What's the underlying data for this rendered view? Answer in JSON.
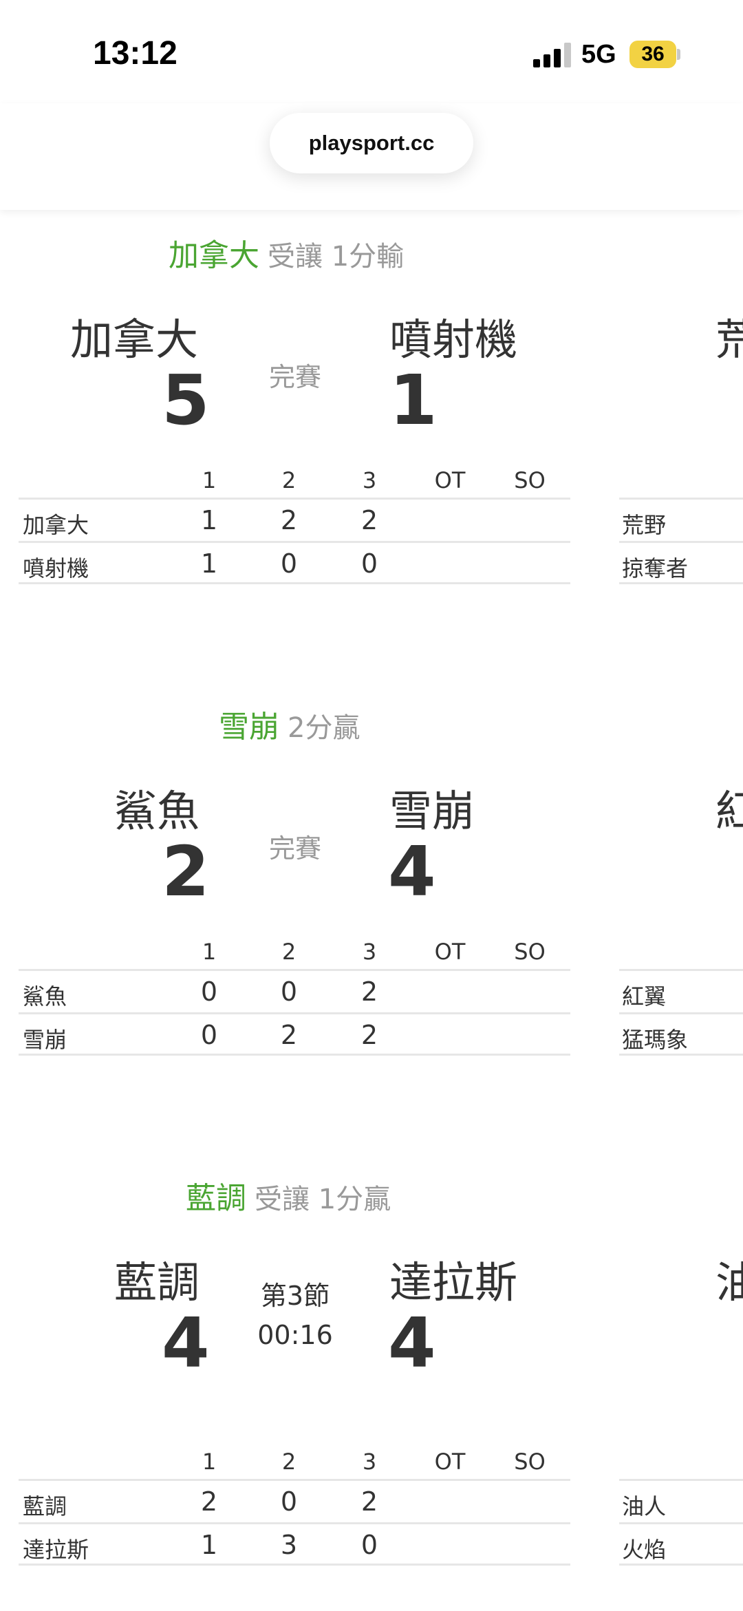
{
  "status_bar": {
    "time": "13:12",
    "network": "5G",
    "battery": "36"
  },
  "browser": {
    "url": "playsport.cc"
  },
  "period_headers": [
    "1",
    "2",
    "3",
    "OT",
    "SO"
  ],
  "games": [
    {
      "pick_team": "加拿大",
      "pick_note": "受讓 1分輸",
      "home_name": "加拿大",
      "home_score": "5",
      "away_name": "噴射機",
      "away_score": "1",
      "status": "完賽",
      "rows": [
        {
          "team": "加拿大",
          "p1": "1",
          "p2": "2",
          "p3": "2",
          "ot": "",
          "so": ""
        },
        {
          "team": "噴射機",
          "p1": "1",
          "p2": "0",
          "p3": "0",
          "ot": "",
          "so": ""
        }
      ],
      "side": {
        "name_partial": "荒",
        "row1": "荒野",
        "row2": "掠奪者"
      }
    },
    {
      "pick_team": "雪崩",
      "pick_note": "2分贏",
      "home_name": "鯊魚",
      "home_score": "2",
      "away_name": "雪崩",
      "away_score": "4",
      "status": "完賽",
      "rows": [
        {
          "team": "鯊魚",
          "p1": "0",
          "p2": "0",
          "p3": "2",
          "ot": "",
          "so": ""
        },
        {
          "team": "雪崩",
          "p1": "0",
          "p2": "2",
          "p3": "2",
          "ot": "",
          "so": ""
        }
      ],
      "side": {
        "name_partial": "紅",
        "row1": "紅翼",
        "row2": "猛瑪象"
      }
    },
    {
      "pick_team": "藍調",
      "pick_note": "受讓 1分贏",
      "home_name": "藍調",
      "home_score": "4",
      "away_name": "達拉斯",
      "away_score": "4",
      "status_period": "第3節",
      "status_clock": "00:16",
      "rows": [
        {
          "team": "藍調",
          "p1": "2",
          "p2": "0",
          "p3": "2",
          "ot": "",
          "so": ""
        },
        {
          "team": "達拉斯",
          "p1": "1",
          "p2": "3",
          "p3": "0",
          "ot": "",
          "so": ""
        }
      ],
      "side": {
        "name_partial": "油",
        "row1": "油人",
        "row2": "火焰"
      }
    }
  ]
}
